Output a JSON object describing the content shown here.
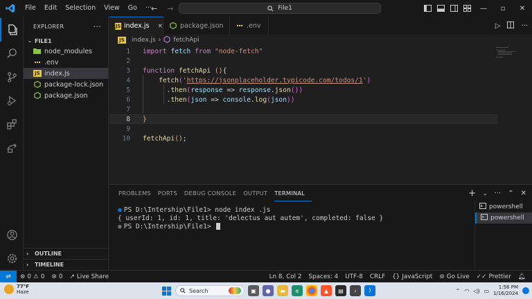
{
  "menu": [
    "File",
    "Edit",
    "Selection",
    "View",
    "Go",
    "···"
  ],
  "command_center": {
    "label": "File1",
    "icon": "search-icon"
  },
  "activity": [
    "explorer-icon",
    "search-icon",
    "source-control-icon",
    "run-debug-icon",
    "extensions-icon",
    "remote-explorer-icon"
  ],
  "activity_bottom": [
    "account-icon",
    "gear-icon"
  ],
  "sidebar": {
    "header": "EXPLORER",
    "more": "···",
    "folder": "FILE1",
    "items": [
      {
        "label": "node_modules",
        "icon": "folder-node-icon",
        "chevron": "›"
      },
      {
        "label": ".env",
        "icon": "env-file-icon"
      },
      {
        "label": "index.js",
        "icon": "js-file-icon"
      },
      {
        "label": "package-lock.json",
        "icon": "json-file-icon"
      },
      {
        "label": "package.json",
        "icon": "json-file-icon"
      }
    ],
    "sections": [
      "OUTLINE",
      "TIMELINE"
    ]
  },
  "tabs": [
    {
      "label": "index.js",
      "icon": "js-file-icon",
      "close": "×"
    },
    {
      "label": "package.json",
      "icon": "json-file-icon"
    },
    {
      "label": ".env",
      "icon": "env-file-icon"
    }
  ],
  "breadcrumb": {
    "file": "index.js",
    "separator": "›",
    "symbol": "fetchApi"
  },
  "code_lines": [
    {
      "n": "1",
      "tokens": [
        [
          "kw",
          "import"
        ],
        [
          "op",
          " "
        ],
        [
          "var",
          "fetch"
        ],
        [
          "op",
          " "
        ],
        [
          "kw",
          "from"
        ],
        [
          "op",
          " "
        ],
        [
          "str",
          "\"node-fetch\""
        ]
      ]
    },
    {
      "n": "2",
      "tokens": []
    },
    {
      "n": "3",
      "tokens": [
        [
          "kw",
          "function"
        ],
        [
          "op",
          " "
        ],
        [
          "fn",
          "fetchApi"
        ],
        [
          "op",
          " "
        ],
        [
          "par",
          "()"
        ],
        [
          "op",
          "{"
        ]
      ]
    },
    {
      "n": "4",
      "tokens": [
        [
          "op",
          "    "
        ],
        [
          "fn",
          "fetch"
        ],
        [
          "par2",
          "("
        ],
        [
          "str",
          "'"
        ],
        [
          "url",
          "https://jsonplaceholder.typicode.com/todos/1"
        ],
        [
          "str",
          "'"
        ],
        [
          "par2",
          ")"
        ]
      ]
    },
    {
      "n": "5",
      "tokens": [
        [
          "op",
          "      ."
        ],
        [
          "fn",
          "then"
        ],
        [
          "par2",
          "("
        ],
        [
          "var",
          "response"
        ],
        [
          "op",
          " => "
        ],
        [
          "var",
          "response"
        ],
        [
          "op",
          "."
        ],
        [
          "fn",
          "json"
        ],
        [
          "par2",
          "())"
        ]
      ]
    },
    {
      "n": "6",
      "tokens": [
        [
          "op",
          "      ."
        ],
        [
          "fn",
          "then"
        ],
        [
          "par2",
          "("
        ],
        [
          "var",
          "json"
        ],
        [
          "op",
          " => "
        ],
        [
          "var",
          "console"
        ],
        [
          "op",
          "."
        ],
        [
          "fn",
          "log"
        ],
        [
          "par2",
          "("
        ],
        [
          "var",
          "json"
        ],
        [
          "par2",
          "))"
        ]
      ]
    },
    {
      "n": "7",
      "tokens": []
    },
    {
      "n": "8",
      "tokens": [
        [
          "par",
          "}"
        ]
      ]
    },
    {
      "n": "9",
      "tokens": []
    },
    {
      "n": "10",
      "tokens": [
        [
          "fn",
          "fetchApi"
        ],
        [
          "par",
          "()"
        ],
        [
          "op",
          ";"
        ]
      ]
    }
  ],
  "panel": {
    "tabs": [
      "PROBLEMS",
      "PORTS",
      "DEBUG CONSOLE",
      "OUTPUT",
      "TERMINAL"
    ],
    "active_tab": "TERMINAL",
    "terminal_lines": [
      "PS D:\\Intership\\File1> node index .js",
      "{ userId: 1, id: 1, title: 'delectus aut autem', completed: false }",
      "PS D:\\Intership\\File1> "
    ],
    "terminals": [
      "powershell",
      "powershell"
    ]
  },
  "status": {
    "errors": "0",
    "warnings": "0",
    "ports": "0",
    "live_share": "Live Share",
    "position": "Ln 8, Col 2",
    "spaces": "Spaces: 4",
    "encoding": "UTF-8",
    "eol": "CRLF",
    "language": "JavaScript",
    "go_live": "Go Live",
    "prettier": "Prettier"
  },
  "taskbar": {
    "weather_temp": "77°F",
    "weather_desc": "Haze",
    "search": "Search",
    "time": "1:56 PM",
    "date": "1/16/2024"
  },
  "colors": {
    "accent": "#0078d4",
    "keyword": "#c586c0",
    "function": "#dcdcaa",
    "string": "#ce9178",
    "variable": "#9cdcfe"
  }
}
